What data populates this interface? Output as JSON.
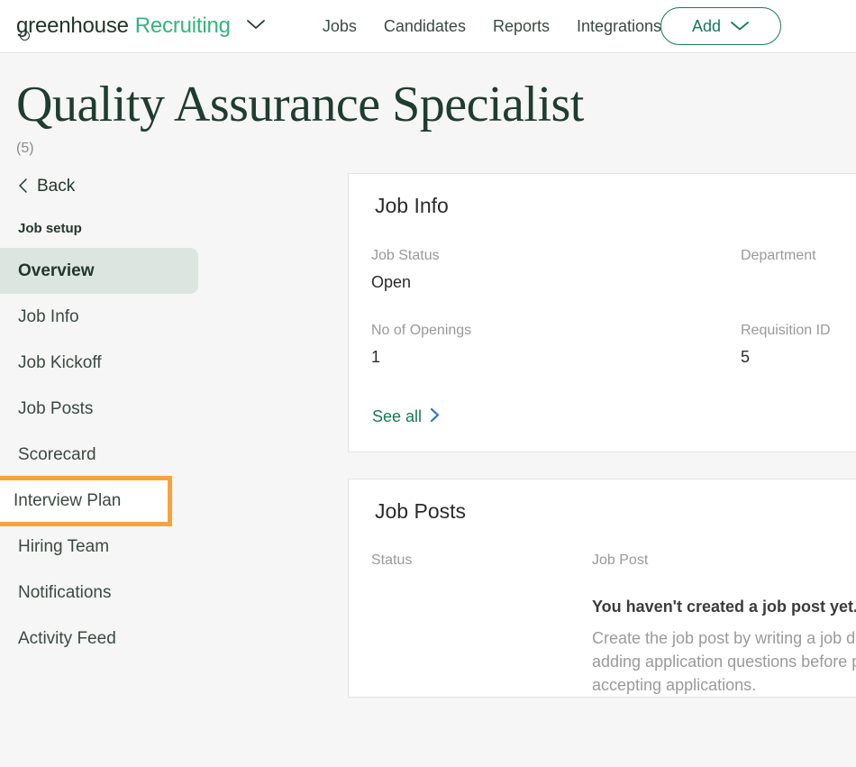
{
  "header": {
    "brand": {
      "name_dark": "greenhouse",
      "name_accent": "Recruiting",
      "chevron": "chevron-down"
    },
    "nav_items": [
      {
        "label": "Jobs"
      },
      {
        "label": "Candidates"
      },
      {
        "label": "Reports"
      },
      {
        "label": "Integrations"
      }
    ],
    "add_button": {
      "label": "Add",
      "chevron": "chevron-down"
    },
    "accent_color": "#36b37e",
    "button_color": "#16795c"
  },
  "page": {
    "title": "Quality Assurance Specialist",
    "subtitle": "(5)"
  },
  "sidebar": {
    "back_label": "Back",
    "back_chevron": "chevron-left",
    "section_heading": "Job setup",
    "items": [
      {
        "label": "Overview",
        "state": "active"
      },
      {
        "label": "Job Info",
        "state": "default"
      },
      {
        "label": "Job Kickoff",
        "state": "default"
      },
      {
        "label": "Job Posts",
        "state": "default"
      },
      {
        "label": "Scorecard",
        "state": "default"
      },
      {
        "label": "Interview Plan",
        "state": "annotated"
      },
      {
        "label": "Hiring Team",
        "state": "default"
      },
      {
        "label": "Notifications",
        "state": "default"
      },
      {
        "label": "Activity Feed",
        "state": "default"
      }
    ],
    "active_bg": "#dde5e0",
    "annotation_color": "#f5a43c"
  },
  "job_info_card": {
    "title": "Job Info",
    "fields": [
      {
        "label": "Job Status",
        "value": "Open"
      },
      {
        "label": "Department",
        "value": ""
      },
      {
        "label": "No of Openings",
        "value": "1"
      },
      {
        "label": "Requisition ID",
        "value": "5"
      }
    ],
    "see_all_label": "See all",
    "see_all_chevron": "chevron-right"
  },
  "job_posts_card": {
    "title": "Job Posts",
    "col_status_label": "Status",
    "col_status_value": "",
    "col_post_label": "Job Post",
    "empty_title": "You haven't created a job post yet.",
    "empty_desc": "Create the job post by writing a job description and adding application questions before publishing it and accepting applications."
  }
}
